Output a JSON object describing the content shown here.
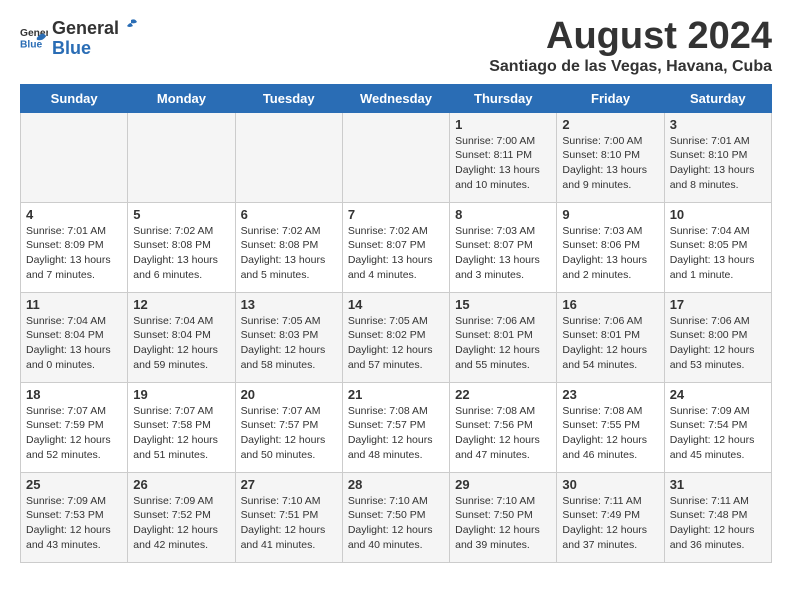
{
  "logo": {
    "general": "General",
    "blue": "Blue"
  },
  "title": "August 2024",
  "subtitle": "Santiago de las Vegas, Havana, Cuba",
  "days_of_week": [
    "Sunday",
    "Monday",
    "Tuesday",
    "Wednesday",
    "Thursday",
    "Friday",
    "Saturday"
  ],
  "weeks": [
    [
      {
        "day": "",
        "content": ""
      },
      {
        "day": "",
        "content": ""
      },
      {
        "day": "",
        "content": ""
      },
      {
        "day": "",
        "content": ""
      },
      {
        "day": "1",
        "content": "Sunrise: 7:00 AM\nSunset: 8:11 PM\nDaylight: 13 hours and 10 minutes."
      },
      {
        "day": "2",
        "content": "Sunrise: 7:00 AM\nSunset: 8:10 PM\nDaylight: 13 hours and 9 minutes."
      },
      {
        "day": "3",
        "content": "Sunrise: 7:01 AM\nSunset: 8:10 PM\nDaylight: 13 hours and 8 minutes."
      }
    ],
    [
      {
        "day": "4",
        "content": "Sunrise: 7:01 AM\nSunset: 8:09 PM\nDaylight: 13 hours and 7 minutes."
      },
      {
        "day": "5",
        "content": "Sunrise: 7:02 AM\nSunset: 8:08 PM\nDaylight: 13 hours and 6 minutes."
      },
      {
        "day": "6",
        "content": "Sunrise: 7:02 AM\nSunset: 8:08 PM\nDaylight: 13 hours and 5 minutes."
      },
      {
        "day": "7",
        "content": "Sunrise: 7:02 AM\nSunset: 8:07 PM\nDaylight: 13 hours and 4 minutes."
      },
      {
        "day": "8",
        "content": "Sunrise: 7:03 AM\nSunset: 8:07 PM\nDaylight: 13 hours and 3 minutes."
      },
      {
        "day": "9",
        "content": "Sunrise: 7:03 AM\nSunset: 8:06 PM\nDaylight: 13 hours and 2 minutes."
      },
      {
        "day": "10",
        "content": "Sunrise: 7:04 AM\nSunset: 8:05 PM\nDaylight: 13 hours and 1 minute."
      }
    ],
    [
      {
        "day": "11",
        "content": "Sunrise: 7:04 AM\nSunset: 8:04 PM\nDaylight: 13 hours and 0 minutes."
      },
      {
        "day": "12",
        "content": "Sunrise: 7:04 AM\nSunset: 8:04 PM\nDaylight: 12 hours and 59 minutes."
      },
      {
        "day": "13",
        "content": "Sunrise: 7:05 AM\nSunset: 8:03 PM\nDaylight: 12 hours and 58 minutes."
      },
      {
        "day": "14",
        "content": "Sunrise: 7:05 AM\nSunset: 8:02 PM\nDaylight: 12 hours and 57 minutes."
      },
      {
        "day": "15",
        "content": "Sunrise: 7:06 AM\nSunset: 8:01 PM\nDaylight: 12 hours and 55 minutes."
      },
      {
        "day": "16",
        "content": "Sunrise: 7:06 AM\nSunset: 8:01 PM\nDaylight: 12 hours and 54 minutes."
      },
      {
        "day": "17",
        "content": "Sunrise: 7:06 AM\nSunset: 8:00 PM\nDaylight: 12 hours and 53 minutes."
      }
    ],
    [
      {
        "day": "18",
        "content": "Sunrise: 7:07 AM\nSunset: 7:59 PM\nDaylight: 12 hours and 52 minutes."
      },
      {
        "day": "19",
        "content": "Sunrise: 7:07 AM\nSunset: 7:58 PM\nDaylight: 12 hours and 51 minutes."
      },
      {
        "day": "20",
        "content": "Sunrise: 7:07 AM\nSunset: 7:57 PM\nDaylight: 12 hours and 50 minutes."
      },
      {
        "day": "21",
        "content": "Sunrise: 7:08 AM\nSunset: 7:57 PM\nDaylight: 12 hours and 48 minutes."
      },
      {
        "day": "22",
        "content": "Sunrise: 7:08 AM\nSunset: 7:56 PM\nDaylight: 12 hours and 47 minutes."
      },
      {
        "day": "23",
        "content": "Sunrise: 7:08 AM\nSunset: 7:55 PM\nDaylight: 12 hours and 46 minutes."
      },
      {
        "day": "24",
        "content": "Sunrise: 7:09 AM\nSunset: 7:54 PM\nDaylight: 12 hours and 45 minutes."
      }
    ],
    [
      {
        "day": "25",
        "content": "Sunrise: 7:09 AM\nSunset: 7:53 PM\nDaylight: 12 hours and 43 minutes."
      },
      {
        "day": "26",
        "content": "Sunrise: 7:09 AM\nSunset: 7:52 PM\nDaylight: 12 hours and 42 minutes."
      },
      {
        "day": "27",
        "content": "Sunrise: 7:10 AM\nSunset: 7:51 PM\nDaylight: 12 hours and 41 minutes."
      },
      {
        "day": "28",
        "content": "Sunrise: 7:10 AM\nSunset: 7:50 PM\nDaylight: 12 hours and 40 minutes."
      },
      {
        "day": "29",
        "content": "Sunrise: 7:10 AM\nSunset: 7:50 PM\nDaylight: 12 hours and 39 minutes."
      },
      {
        "day": "30",
        "content": "Sunrise: 7:11 AM\nSunset: 7:49 PM\nDaylight: 12 hours and 37 minutes."
      },
      {
        "day": "31",
        "content": "Sunrise: 7:11 AM\nSunset: 7:48 PM\nDaylight: 12 hours and 36 minutes."
      }
    ]
  ]
}
